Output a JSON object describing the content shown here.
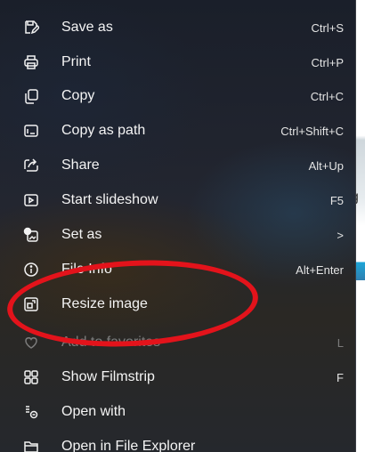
{
  "menu": {
    "items": [
      {
        "icon": "save-as-icon",
        "label": "Save as",
        "shortcut": "Ctrl+S",
        "enabled": true
      },
      {
        "icon": "printer-icon",
        "label": "Print",
        "shortcut": "Ctrl+P",
        "enabled": true
      },
      {
        "icon": "copy-icon",
        "label": "Copy",
        "shortcut": "Ctrl+C",
        "enabled": true
      },
      {
        "icon": "copy-path-icon",
        "label": "Copy as path",
        "shortcut": "Ctrl+Shift+C",
        "enabled": true
      },
      {
        "icon": "share-icon",
        "label": "Share",
        "shortcut": "Alt+Up",
        "enabled": true
      },
      {
        "icon": "slideshow-icon",
        "label": "Start slideshow",
        "shortcut": "F5",
        "enabled": true
      },
      {
        "icon": "set-as-icon",
        "label": "Set as",
        "shortcut": ">",
        "enabled": true
      },
      {
        "icon": "info-icon",
        "label": "File Info",
        "shortcut": "Alt+Enter",
        "enabled": true
      },
      {
        "icon": "resize-image-icon",
        "label": "Resize image",
        "shortcut": "",
        "enabled": true
      },
      {
        "icon": "heart-icon",
        "label": "Add to favorites",
        "shortcut": "L",
        "enabled": false
      },
      {
        "icon": "filmstrip-icon",
        "label": "Show Filmstrip",
        "shortcut": "F",
        "enabled": true
      },
      {
        "icon": "open-with-icon",
        "label": "Open with",
        "shortcut": "",
        "enabled": true
      },
      {
        "icon": "folder-icon",
        "label": "Open in File Explorer",
        "shortcut": "",
        "enabled": true
      }
    ]
  },
  "background": {
    "peek_letter": "g"
  },
  "colors": {
    "annotation": "#e3131b",
    "menu_text": "#f4f4f4",
    "disabled_text": "#7c7c7c"
  }
}
